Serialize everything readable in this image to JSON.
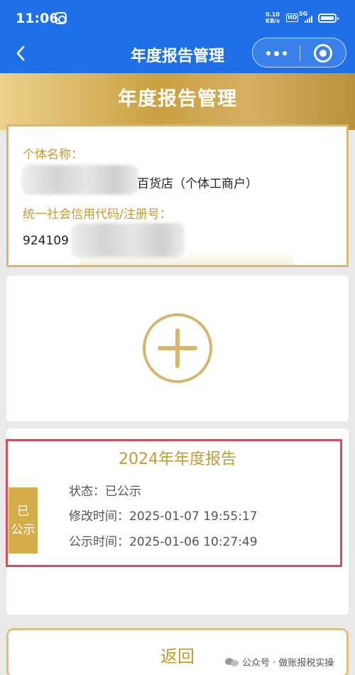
{
  "status_bar": {
    "time": "11:06",
    "net_speed_value": "0.10",
    "net_speed_unit": "KB/s",
    "hd_label": "HD",
    "signal_label": "5G"
  },
  "nav": {
    "title": "年度报告管理"
  },
  "header": {
    "title": "年度报告管理"
  },
  "info": {
    "name_label": "个体名称：",
    "name_value_suffix": "百货店（个体工商户）",
    "code_label": "统一社会信用代码/注册号：",
    "code_value_prefix": "924109"
  },
  "report": {
    "title": "2024年年度报告",
    "badge_line1": "已",
    "badge_line2": "公示",
    "status_label": "状态：",
    "status_value": "已公示",
    "modified_label": "修改时间：",
    "modified_value": "2025-01-07 19:55:17",
    "published_label": "公示时间：",
    "published_value": "2025-01-06 10:27:49"
  },
  "footer": {
    "return_label": "返回",
    "watermark": "公众号 · 做账报税实操"
  },
  "colors": {
    "nav_blue": "#1f6fe8",
    "gold": "#c49a30",
    "highlight_red": "#d44d5c"
  }
}
